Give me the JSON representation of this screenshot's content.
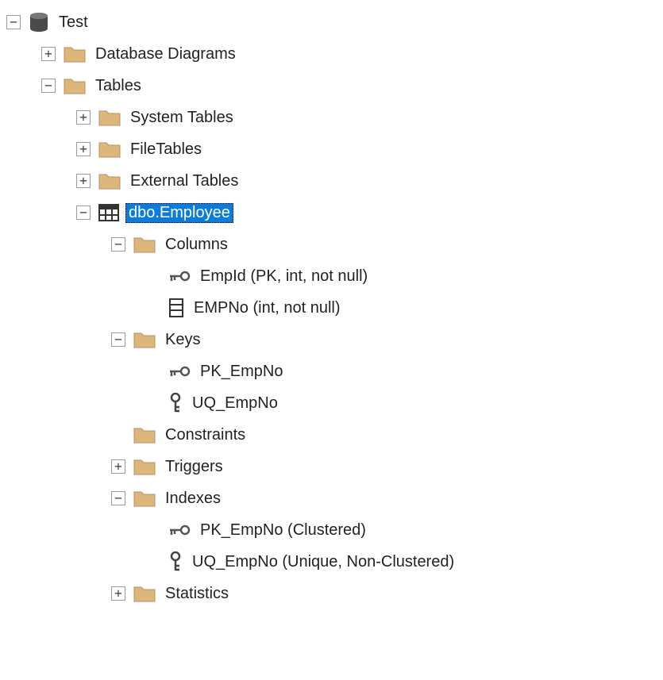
{
  "root": {
    "label": "Test",
    "children": {
      "diagrams": {
        "label": "Database Diagrams"
      },
      "tables": {
        "label": "Tables",
        "children": {
          "systemTables": {
            "label": "System Tables"
          },
          "fileTables": {
            "label": "FileTables"
          },
          "externalTables": {
            "label": "External Tables"
          },
          "employee": {
            "label": "dbo.Employee",
            "children": {
              "columns": {
                "label": "Columns",
                "items": {
                  "empId": {
                    "label": "EmpId (PK, int, not null)"
                  },
                  "empNo": {
                    "label": "EMPNo (int, not null)"
                  }
                }
              },
              "keys": {
                "label": "Keys",
                "items": {
                  "pk": {
                    "label": "PK_EmpNo"
                  },
                  "uq": {
                    "label": "UQ_EmpNo"
                  }
                }
              },
              "constraints": {
                "label": "Constraints"
              },
              "triggers": {
                "label": "Triggers"
              },
              "indexes": {
                "label": "Indexes",
                "items": {
                  "pk": {
                    "label": "PK_EmpNo (Clustered)"
                  },
                  "uq": {
                    "label": "UQ_EmpNo (Unique, Non-Clustered)"
                  }
                }
              },
              "statistics": {
                "label": "Statistics"
              }
            }
          }
        }
      }
    }
  }
}
